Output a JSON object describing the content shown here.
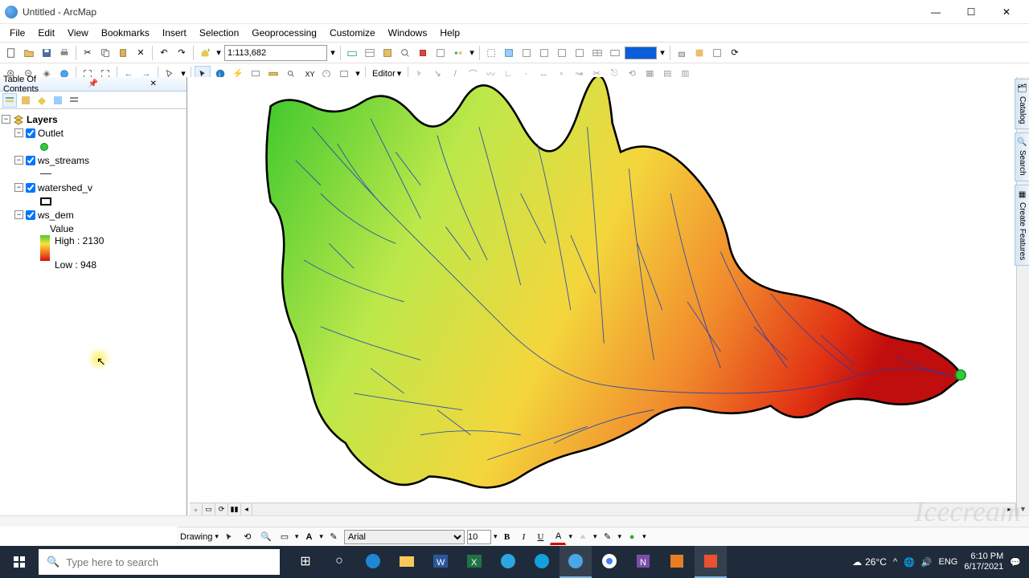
{
  "window": {
    "title": "Untitled - ArcMap",
    "minimize": "—",
    "maximize": "☐",
    "close": "✕"
  },
  "menu": [
    "File",
    "Edit",
    "View",
    "Bookmarks",
    "Insert",
    "Selection",
    "Geoprocessing",
    "Customize",
    "Windows",
    "Help"
  ],
  "scale_value": "1:113,682",
  "editor_label": "Editor",
  "toc": {
    "title": "Table Of Contents",
    "root": "Layers",
    "layers": [
      {
        "name": "Outlet",
        "checked": true,
        "symbol": "point-green"
      },
      {
        "name": "ws_streams",
        "checked": true,
        "symbol": "line"
      },
      {
        "name": "watershed_v",
        "checked": true,
        "symbol": "polygon"
      },
      {
        "name": "ws_dem",
        "checked": true,
        "symbol": "raster",
        "value_label": "Value",
        "high": "High : 2130",
        "low": "Low : 948"
      }
    ]
  },
  "dock_tabs": [
    "Catalog",
    "Search",
    "Create Features"
  ],
  "drawing": {
    "label": "Drawing",
    "font": "Arial",
    "size": "10",
    "bold": "B",
    "italic": "I",
    "underline": "U"
  },
  "taskbar": {
    "search_placeholder": "Type here to search",
    "weather_temp": "26°C",
    "lang": "ENG",
    "time": "6:10 PM",
    "date": "6/17/2021"
  },
  "watermark": "Icecream"
}
